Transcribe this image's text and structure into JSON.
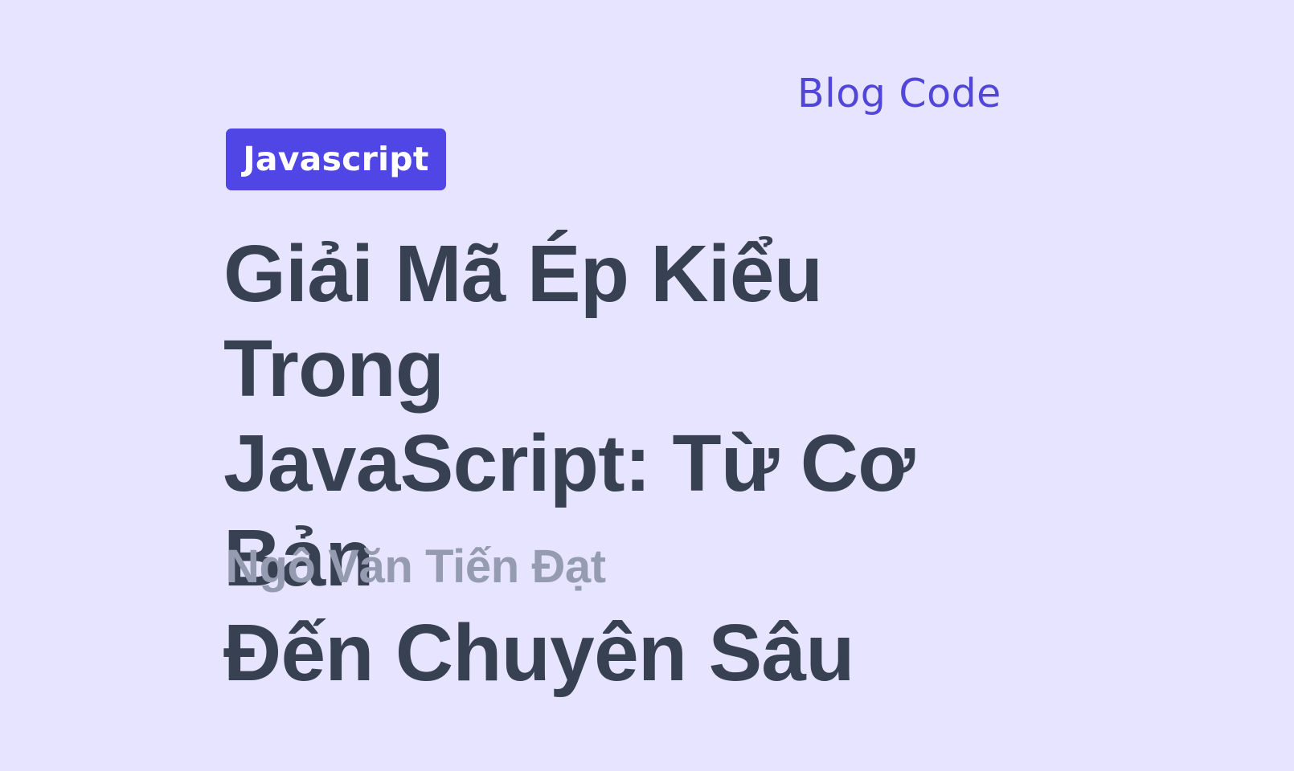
{
  "brand": {
    "label": "Blog Code"
  },
  "post": {
    "category": "Javascript",
    "title": "Giải Mã Ép Kiểu Trong\nJavaScript: Từ Cơ Bản\nĐến Chuyên Sâu",
    "author": "Ngô Văn Tiến Đạt"
  },
  "colors": {
    "background": "#e6e4ff",
    "accent": "#4f46e5",
    "title": "#374151",
    "author": "#959cb1"
  }
}
